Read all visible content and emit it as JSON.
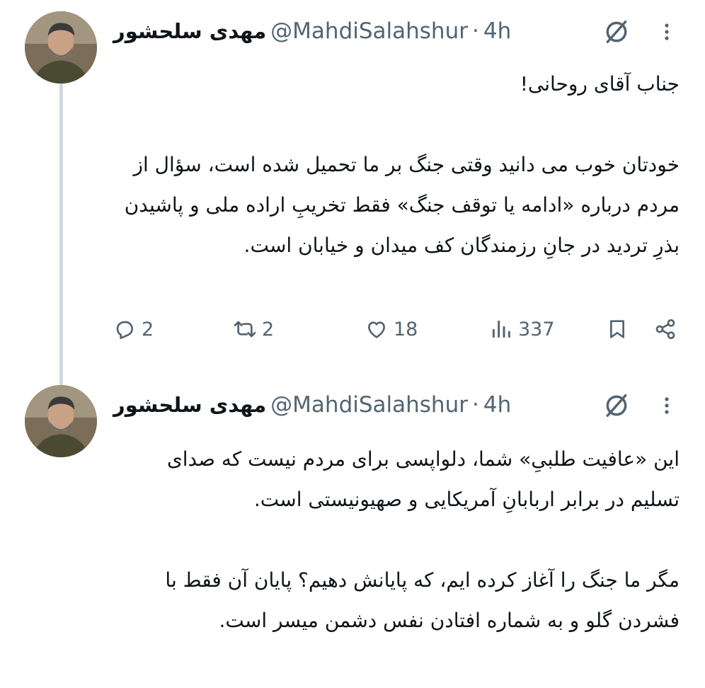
{
  "tweets": [
    {
      "display_name": "مهدی سلحشور",
      "handle": "@MahdiSalahshur",
      "separator": "·",
      "time": "4h",
      "paragraphs": [
        "جناب آقای روحانی!",
        "خودتان خوب می دانید وقتی جنگ بر ما تحمیل شده است، سؤال از مردم درباره «ادامه یا توقف جنگ» فقط تخریبِ اراده ملی و پاشیدن بذرِ تردید در جانِ رزمندگان کف میدان و خیابان است."
      ],
      "actions": {
        "replies": "2",
        "reposts": "2",
        "likes": "18",
        "views": "337"
      }
    },
    {
      "display_name": "مهدی سلحشور",
      "handle": "@MahdiSalahshur",
      "separator": "·",
      "time": "4h",
      "paragraphs": [
        "این «عافیت طلبیِ» شما، دلواپسی برای مردم نیست که صدای تسلیم در برابر اربابانِ آمریکایی و صهیونیستی است.",
        "مگر ما جنگ را آغاز کرده ایم، که پایانش دهیم؟ پایان آن فقط با فشردن گلو و به شماره افتادن نفس دشمن میسر است."
      ]
    }
  ],
  "icons": {
    "grok": "grok-icon",
    "more": "more-vertical-icon",
    "reply": "reply-icon",
    "repost": "repost-icon",
    "like": "heart-icon",
    "views": "views-icon",
    "bookmark": "bookmark-icon",
    "share": "share-icon"
  },
  "colors": {
    "text": "#0f1419",
    "secondary": "#536471",
    "thread_line": "#cfd9de"
  }
}
